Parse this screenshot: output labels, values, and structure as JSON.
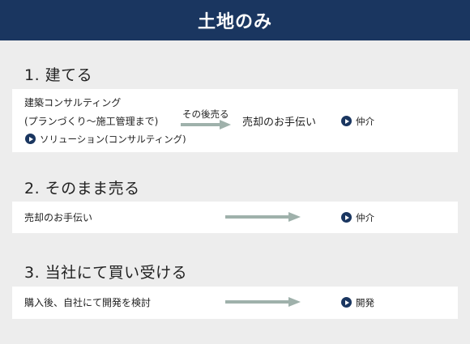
{
  "header": {
    "title": "土地のみ"
  },
  "section1": {
    "title": "1. 建てる",
    "line1": "建築コンサルティング",
    "line2": "(プランづくり〜施工管理まで)",
    "sublink": "ソリューション(コンサルティング)",
    "arrow_label": "その後売る",
    "result": "売却のお手伝い",
    "link": "仲介"
  },
  "section2": {
    "title": "2. そのまま売る",
    "item": "売却のお手伝い",
    "link": "仲介"
  },
  "section3": {
    "title": "3. 当社にて買い受ける",
    "item": "購入後、自社にて開発を検討",
    "link": "開発"
  },
  "colors": {
    "header_bg": "#1a3660",
    "arrow": "#9fb1ab",
    "page_bg": "#ededed"
  }
}
